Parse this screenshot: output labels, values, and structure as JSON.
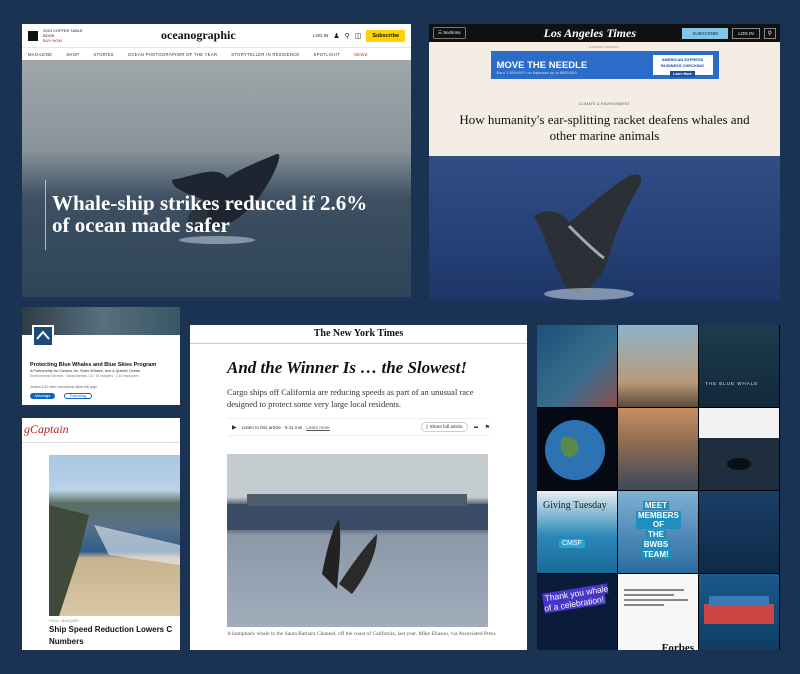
{
  "oceanographic": {
    "promo_line1": "2024 COFFEE TABLE BOOK",
    "promo_line2": "BUY NOW",
    "logo": "oceanographic",
    "login": "LOG IN",
    "subscribe": "Subscribe",
    "nav": [
      "MAGAZINE",
      "SHOP",
      "STORIES",
      "OCEAN PHOTOGRAPHER OF THE YEAR",
      "STORYTELLER IN RESIDENCE",
      "SPOTLIGHT",
      "NEWS"
    ],
    "headline": "Whale-ship strikes reduced if 2.6% of ocean made safer"
  },
  "latimes": {
    "sections": "Sections",
    "logo": "Los Angeles Times",
    "subscribe": "SUBSCRIBE",
    "login": "LOG IN",
    "ad_label": "ADVERTISEMENT",
    "ad_headline": "MOVE THE NEEDLE",
    "ad_sub": "Earn 1.30% APY on balances up to $500,000.",
    "ad_brand": "AMERICAN EXPRESS",
    "ad_brand_sub": "BUSINESS CHECKING",
    "ad_cta": "Learn More",
    "kicker": "CLIMATE & ENVIRONMENT",
    "headline": "How humanity's ear-splitting racket deafens whales and other marine animals"
  },
  "linkedin": {
    "name": "Protecting Blue Whales and Blue Skies Program",
    "tagline": "A Partnership for Cleaner Air, Safer Whales, and a Quieter Ocean",
    "meta": "Environmental Services · Santa Barbara, CA · 1K followers · 2-10 employees",
    "connections": "Jessica & 62 other connections follow this page",
    "message": "Message",
    "following": "Following"
  },
  "gcaptain": {
    "logo": "gCaptain",
    "credit": "Photo: BAAQMD",
    "headline": "Ship Speed Reduction Lowers C",
    "headline2": "Numbers"
  },
  "nyt": {
    "logo": "The New York Times",
    "headline": "And the Winner Is … the Slowest!",
    "dek": "Cargo ships off California are reducing speeds as part of an unusual race designed to protect some very large local residents.",
    "listen": "Listen to this article · 5:11 min",
    "learn_more": "Learn more",
    "share": "Share full article",
    "caption": "A humpback whale in the Santa Barbara Channel, off the coast of California, last year.",
    "credit": "Mike Eliason, via Associated Press"
  },
  "instagram": {
    "meet": [
      "MEET",
      "MEMBERS OF",
      "THE",
      "BWBS",
      "TEAM!"
    ],
    "thank": "Thank you whale of a celebration!",
    "giving": "Giving Tuesday",
    "cmsf": "CMSF",
    "forbes": "Forbes",
    "blue_whale": "THE BLUE WHALE"
  }
}
